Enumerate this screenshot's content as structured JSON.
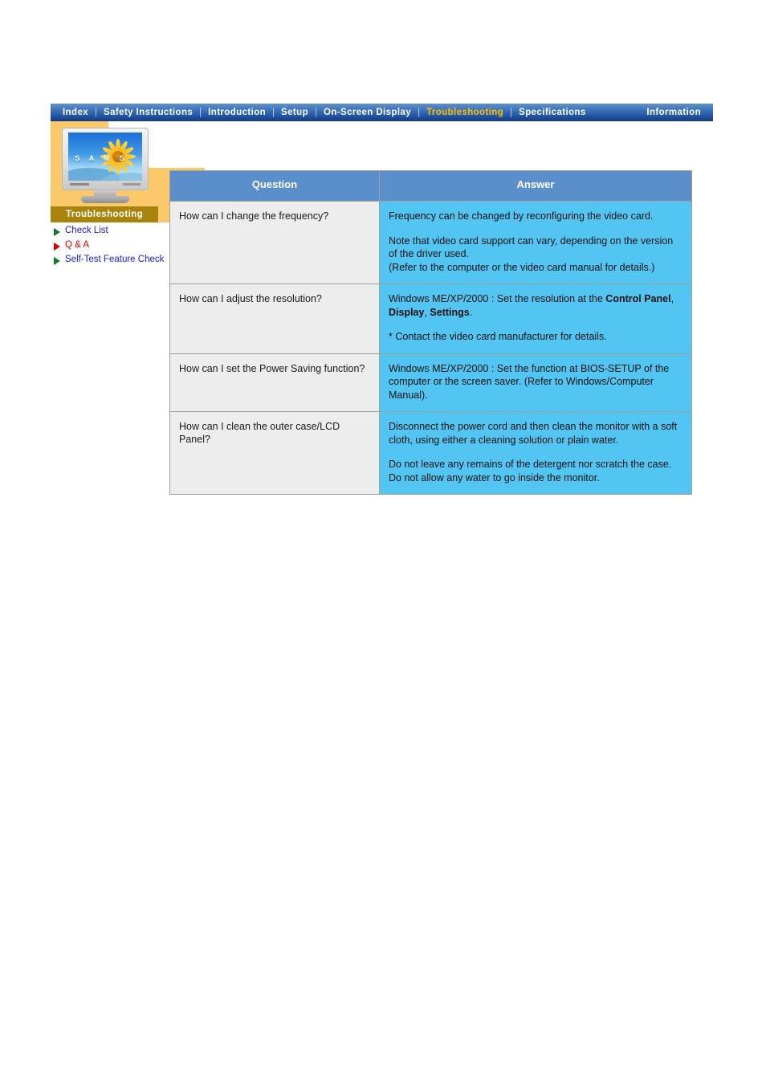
{
  "nav": {
    "separator": "|",
    "items": [
      {
        "label": "Index",
        "active": false,
        "sep_after": true
      },
      {
        "label": "Safety Instructions",
        "active": false,
        "sep_after": true
      },
      {
        "label": "Introduction",
        "active": false,
        "sep_after": true
      },
      {
        "label": "Setup",
        "active": false,
        "sep_after": true
      },
      {
        "label": "On-Screen Display",
        "active": false,
        "sep_after": true
      },
      {
        "label": "Troubleshooting",
        "active": true,
        "sep_after": true
      },
      {
        "label": "Specifications",
        "active": false,
        "sep_after": false
      },
      {
        "label": "Information",
        "active": false,
        "sep_after": false
      }
    ]
  },
  "sidebar": {
    "banner_label": "Troubleshooting",
    "monitor_screen_text": "S A M S",
    "links": [
      {
        "label": "Check List",
        "current": false
      },
      {
        "label": "Q & A",
        "current": true
      },
      {
        "label": "Self-Test Feature Check",
        "current": false
      }
    ]
  },
  "faq": {
    "headers": {
      "question": "Question",
      "answer": "Answer"
    },
    "rows": [
      {
        "question": "How can I change the frequency?",
        "answer_paragraphs": [
          "Frequency can be changed by reconfiguring the video card.",
          "Note that video card support can vary, depending on the version of the driver used.\n(Refer to the computer or the video card manual for details.)"
        ]
      },
      {
        "question": "How can I adjust the resolution?",
        "answer_paragraphs": [
          "Windows ME/XP/2000 : Set the resolution at the Control Panel, Display, Settings.",
          "* Contact the video card manufacturer for details."
        ],
        "answer_bold_terms": [
          "Control Panel",
          "Display",
          "Settings"
        ]
      },
      {
        "question": "How can I set the Power Saving function?",
        "answer_paragraphs": [
          "Windows ME/XP/2000 : Set the function at BIOS-SETUP of the computer or the screen saver. (Refer to Windows/Computer Manual)."
        ]
      },
      {
        "question": "How can I clean the outer case/LCD Panel?",
        "answer_paragraphs": [
          "Disconnect the power cord and then clean the monitor with a soft cloth, using either a cleaning solution or plain water.",
          "Do not leave any remains of the detergent nor scratch the case. Do not allow any water to go inside the monitor."
        ]
      }
    ]
  },
  "colors": {
    "nav_gradient_top": "#5d92cc",
    "nav_gradient_bottom": "#123a80",
    "nav_active_text": "#ffc000",
    "sidebar_panel": "#fcc96a",
    "banner_bg": "#a8840c",
    "table_header_bg": "#5b8fcb",
    "question_cell_bg": "#ededed",
    "answer_cell_bg": "#52c5f2",
    "link_blue": "#1a1ae0",
    "link_current_red": "#e00000",
    "bullet_green": "#11782a"
  }
}
